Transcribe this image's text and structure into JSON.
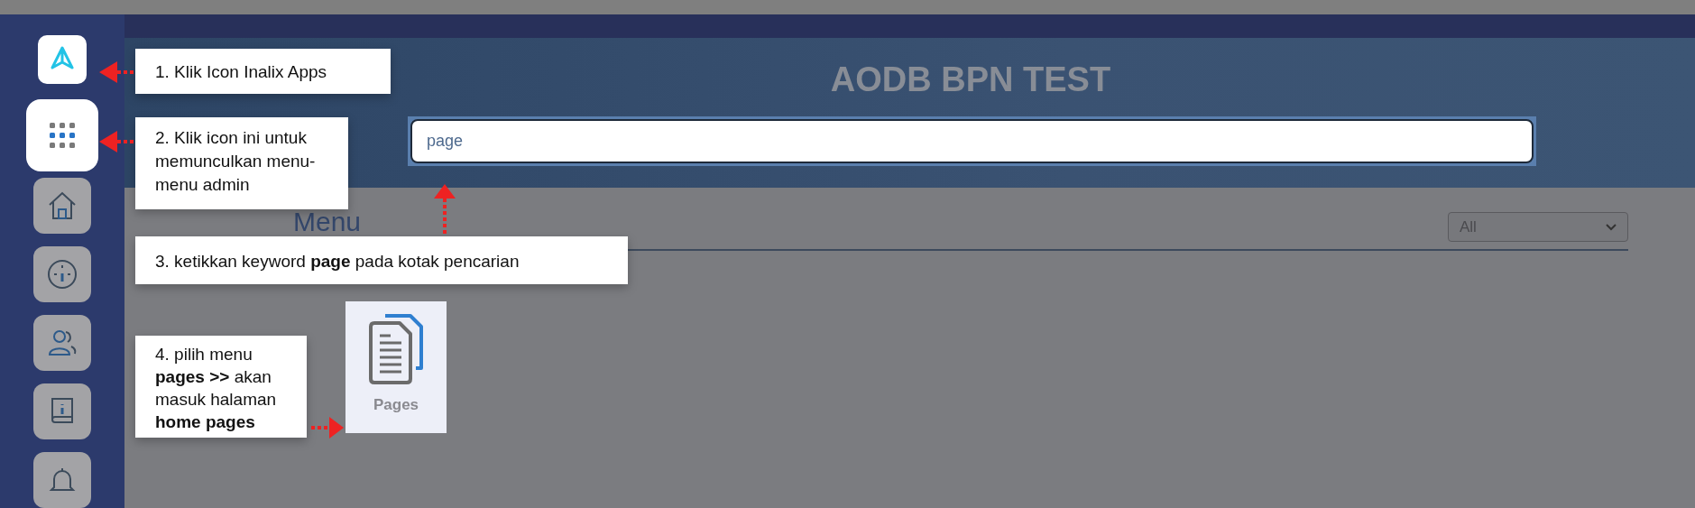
{
  "sidebar": {
    "items": [
      {
        "kind": "logo",
        "highlighted": true
      },
      {
        "kind": "apps",
        "highlighted": true
      },
      {
        "kind": "home",
        "highlighted": false
      },
      {
        "kind": "gauge",
        "highlighted": false
      },
      {
        "kind": "users",
        "highlighted": false
      },
      {
        "kind": "info",
        "highlighted": false
      },
      {
        "kind": "bell",
        "highlighted": false
      }
    ]
  },
  "header": {
    "title": "AODB BPN TEST",
    "search": {
      "value": "page"
    }
  },
  "menu": {
    "heading": "Menu",
    "filter": {
      "value": "All"
    },
    "items": [
      {
        "label": "Pages"
      }
    ]
  },
  "callouts": [
    {
      "text": "1. Klik Icon Inalix Apps"
    },
    {
      "text": "2. Klik icon ini untuk memunculkan menu-menu admin"
    },
    {
      "text": "3. ketikkan keyword **page** pada kotak pencarian"
    },
    {
      "text": "4. pilih menu **pages >>** akan masuk halaman **home pages**"
    }
  ]
}
